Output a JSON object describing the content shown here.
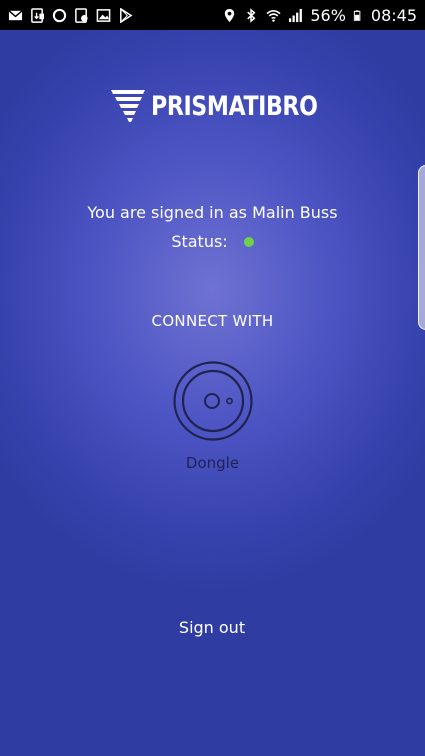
{
  "status_bar": {
    "battery_percent": "56%",
    "time": "08:45",
    "left_icons": [
      "mail-icon",
      "download-icon",
      "circle-icon",
      "chat-icon",
      "image-icon",
      "play-store-icon"
    ],
    "right_icons": [
      "location-icon",
      "bluetooth-icon",
      "wifi-icon",
      "signal-icon",
      "battery-icon"
    ]
  },
  "logo": {
    "text": "PRISMATIBRO"
  },
  "account": {
    "signed_in_text": "You are signed in as Malin Buss",
    "status_label": "Status:",
    "status_color": "#6fd14a"
  },
  "connect": {
    "heading": "CONNECT WITH",
    "device_label": "Dongle",
    "device_icon": "dongle-icon"
  },
  "actions": {
    "sign_out_label": "Sign out"
  },
  "colors": {
    "background": "#4d55c4",
    "text": "#ffffff",
    "dark_text": "#1f2350",
    "status_online": "#6fd14a"
  }
}
